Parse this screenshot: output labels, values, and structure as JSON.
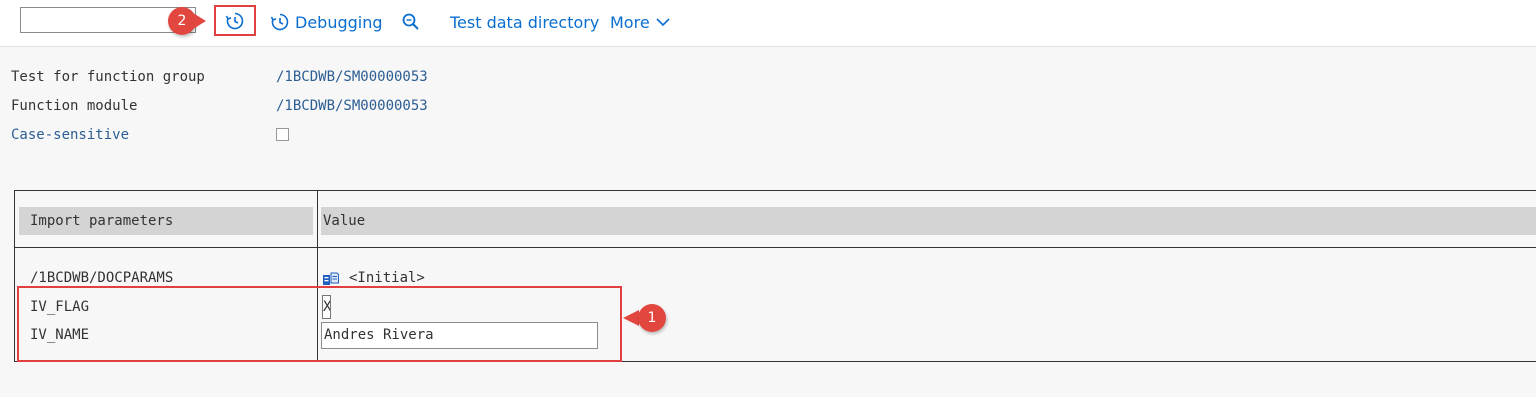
{
  "toolbar": {
    "debugging_label": "Debugging",
    "test_data_label": "Test data directory",
    "more_label": "More"
  },
  "callouts": {
    "toolbar": "2",
    "params": "1"
  },
  "header": {
    "function_group_label": "Test for function group",
    "function_group_value": "/1BCDWB/SM00000053",
    "function_module_label": "Function module",
    "function_module_value": "/1BCDWB/SM00000053",
    "case_sensitive_label": "Case-sensitive"
  },
  "table": {
    "col_import": "Import parameters",
    "col_value": "Value",
    "rows": [
      {
        "name": "/1BCDWB/DOCPARAMS",
        "value": "<Initial>"
      },
      {
        "name": "IV_FLAG",
        "value": "X"
      },
      {
        "name": "IV_NAME",
        "value": "Andres Rivera"
      }
    ]
  },
  "colors": {
    "accent": "#0a6ed1",
    "highlight": "#e04040",
    "badge": "#e2473f"
  }
}
